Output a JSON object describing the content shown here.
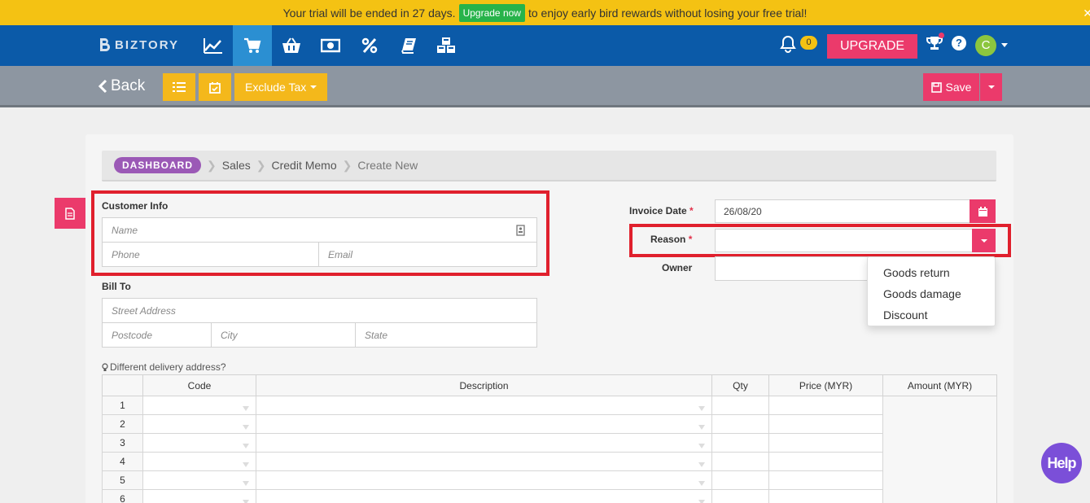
{
  "trial_banner": {
    "text_before": "Your trial will be ended in 27 days.",
    "button": "Upgrade now",
    "text_after": "to enjoy early bird rewards without losing your free trial!"
  },
  "nav": {
    "logo": "BIZTORY",
    "icons": [
      "chart-icon",
      "cart-icon",
      "basket-icon",
      "money-icon",
      "percent-icon",
      "book-icon",
      "cubes-icon"
    ],
    "notification_count": "0",
    "upgrade": "UPGRADE",
    "help_symbol": "?",
    "avatar_initial": "C"
  },
  "toolbar": {
    "back": "Back",
    "exclude_tax": "Exclude Tax",
    "save": "Save"
  },
  "breadcrumb": [
    "DASHBOARD",
    "Sales",
    "Credit Memo",
    "Create New"
  ],
  "customer": {
    "title": "Customer Info",
    "name_ph": "Name",
    "phone_ph": "Phone",
    "email_ph": "Email"
  },
  "bill_to": {
    "title": "Bill To",
    "street_ph": "Street Address",
    "postcode_ph": "Postcode",
    "city_ph": "City",
    "state_ph": "State"
  },
  "right_form": {
    "invoice_date_label": "Invoice Date",
    "invoice_date_value": "26/08/20",
    "reason_label": "Reason",
    "reason_value": "",
    "owner_label": "Owner",
    "required_mark": "*"
  },
  "reason_options": [
    "Goods return",
    "Goods damage",
    "Discount"
  ],
  "delivery_link": "Different delivery address?",
  "table": {
    "headers": [
      "",
      "Code",
      "Description",
      "Qty",
      "Price (MYR)",
      "Amount (MYR)"
    ],
    "rows": [
      "1",
      "2",
      "3",
      "4",
      "5",
      "6"
    ]
  },
  "help_button": "Help",
  "colors": {
    "brand_blue": "#0b5aa8",
    "accent_pink": "#eb3a6b",
    "warning_yellow": "#f4b81b",
    "highlight_red": "#e0202d"
  }
}
